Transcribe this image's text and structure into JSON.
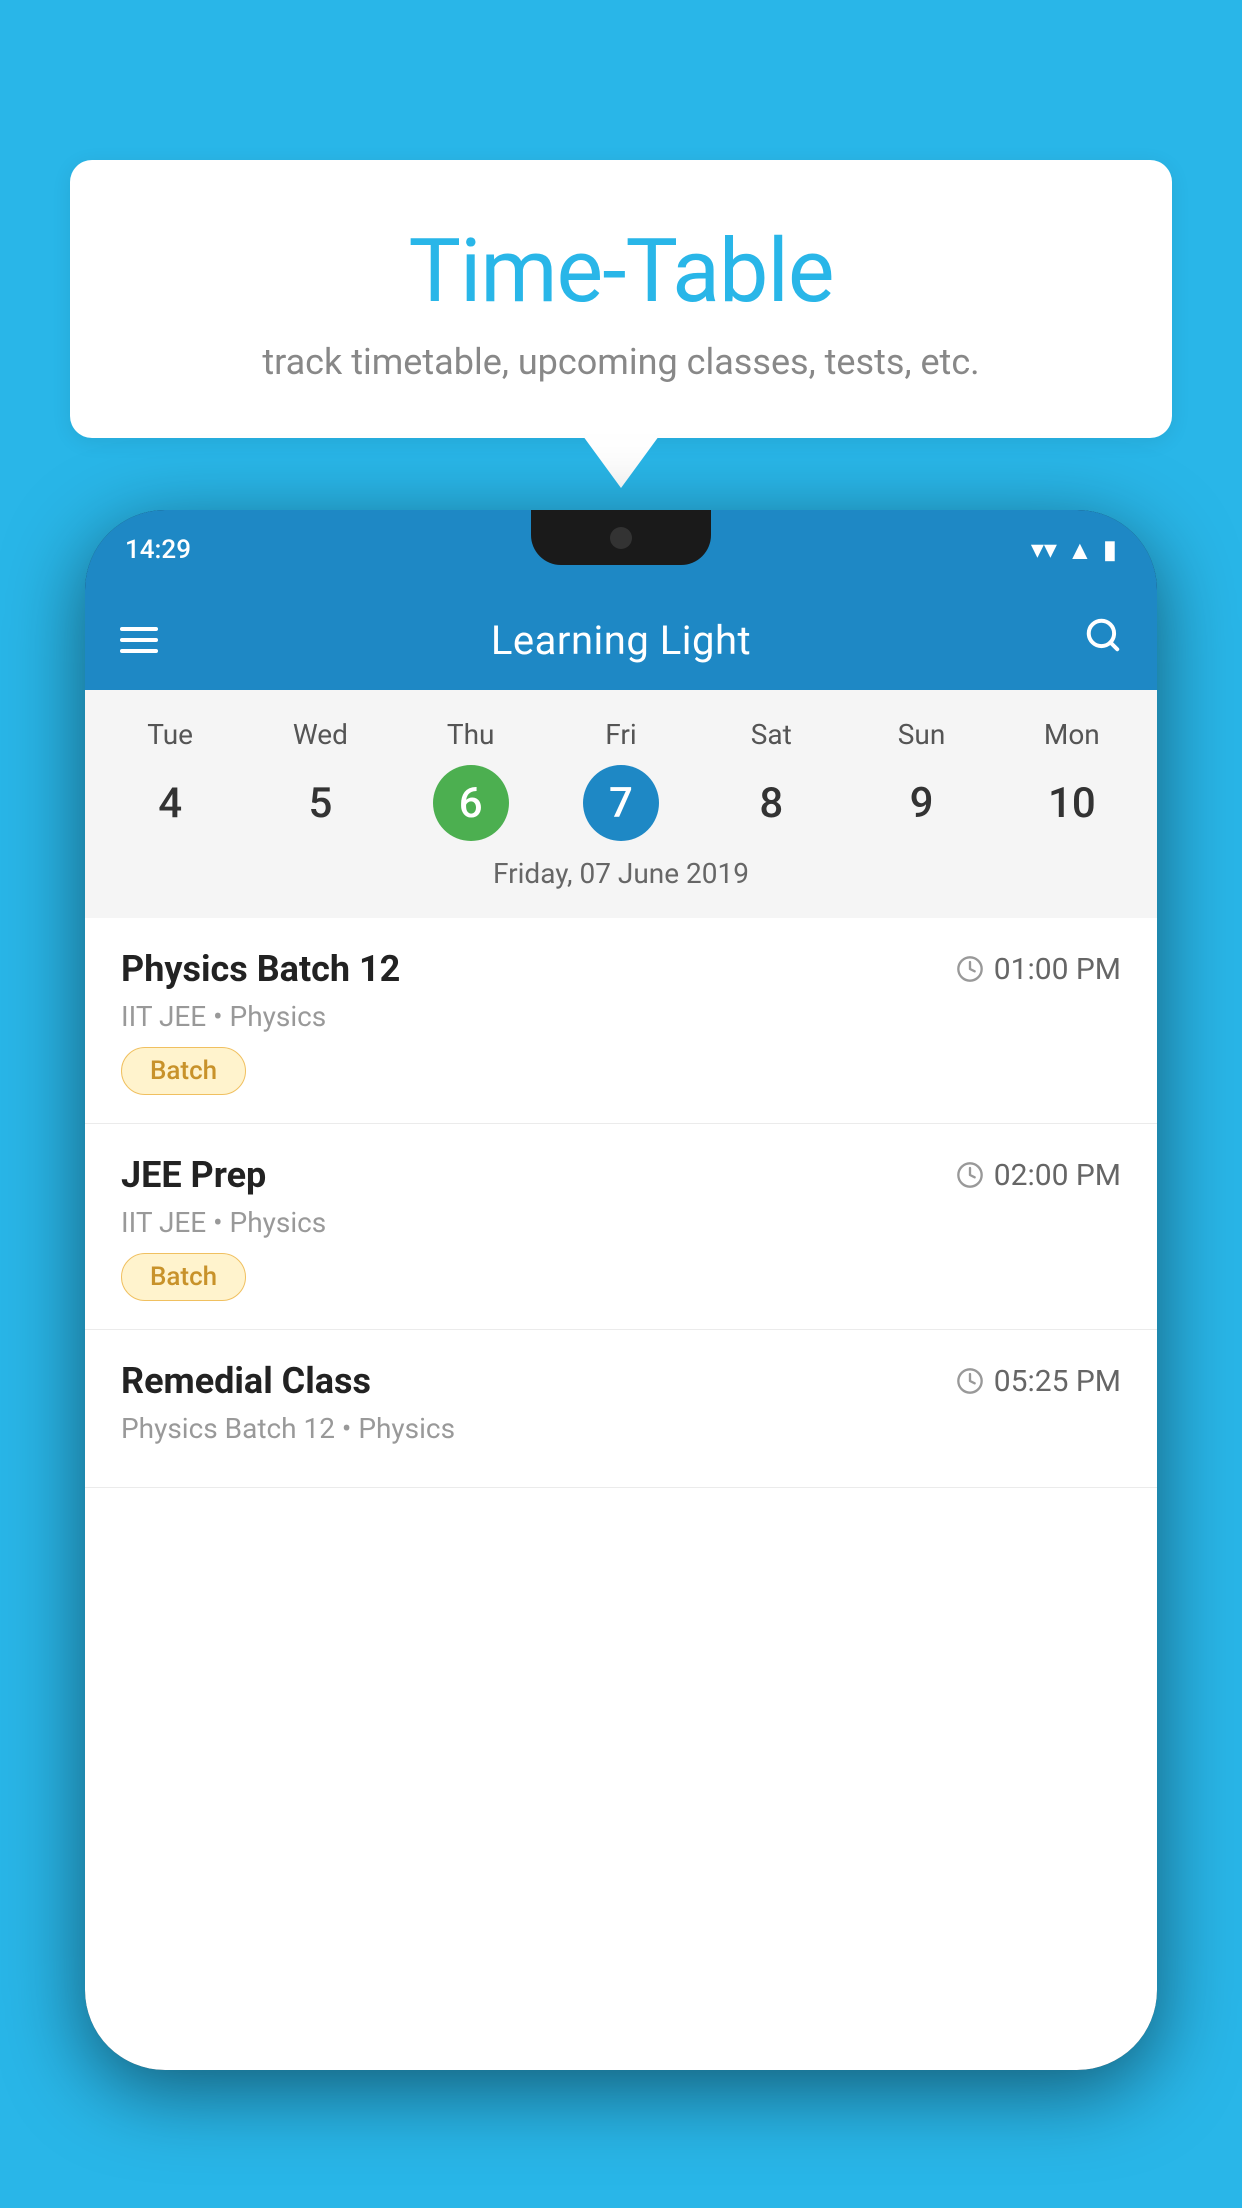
{
  "background_color": "#29b6e8",
  "speech_bubble": {
    "title": "Time-Table",
    "subtitle": "track timetable, upcoming classes, tests, etc."
  },
  "phone": {
    "status_bar": {
      "time": "14:29"
    },
    "app_header": {
      "title": "Learning Light"
    },
    "calendar": {
      "days": [
        {
          "name": "Tue",
          "number": "4",
          "state": "normal"
        },
        {
          "name": "Wed",
          "number": "5",
          "state": "normal"
        },
        {
          "name": "Thu",
          "number": "6",
          "state": "today"
        },
        {
          "name": "Fri",
          "number": "7",
          "state": "selected"
        },
        {
          "name": "Sat",
          "number": "8",
          "state": "normal"
        },
        {
          "name": "Sun",
          "number": "9",
          "state": "normal"
        },
        {
          "name": "Mon",
          "number": "10",
          "state": "normal"
        }
      ],
      "selected_date_label": "Friday, 07 June 2019"
    },
    "classes": [
      {
        "name": "Physics Batch 12",
        "time": "01:00 PM",
        "meta": "IIT JEE • Physics",
        "badge": "Batch"
      },
      {
        "name": "JEE Prep",
        "time": "02:00 PM",
        "meta": "IIT JEE • Physics",
        "badge": "Batch"
      },
      {
        "name": "Remedial Class",
        "time": "05:25 PM",
        "meta": "Physics Batch 12 • Physics",
        "badge": null
      }
    ]
  }
}
